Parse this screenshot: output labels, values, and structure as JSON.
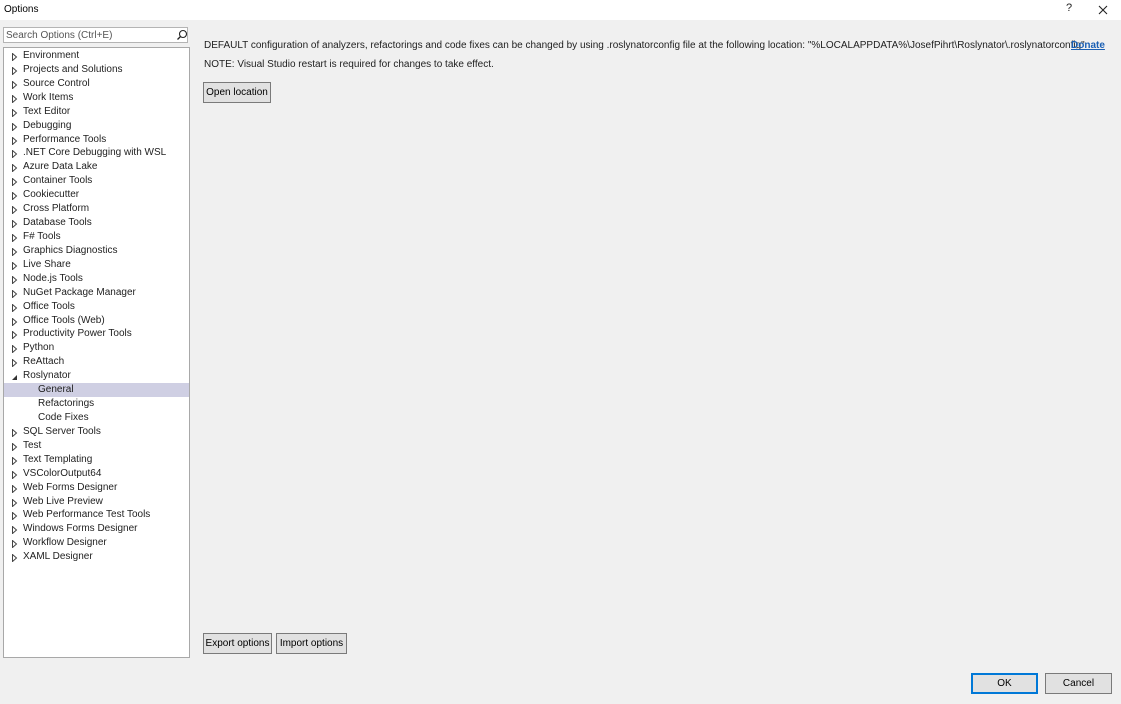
{
  "window": {
    "title": "Options",
    "help_label": "?"
  },
  "search": {
    "placeholder": "Search Options (Ctrl+E)",
    "value": ""
  },
  "tree": {
    "items": [
      {
        "label": "Environment",
        "expander": "collapsed"
      },
      {
        "label": "Projects and Solutions",
        "expander": "collapsed"
      },
      {
        "label": "Source Control",
        "expander": "collapsed"
      },
      {
        "label": "Work Items",
        "expander": "collapsed"
      },
      {
        "label": "Text Editor",
        "expander": "collapsed"
      },
      {
        "label": "Debugging",
        "expander": "collapsed"
      },
      {
        "label": "Performance Tools",
        "expander": "collapsed"
      },
      {
        "label": ".NET Core Debugging with WSL",
        "expander": "collapsed"
      },
      {
        "label": "Azure Data Lake",
        "expander": "collapsed"
      },
      {
        "label": "Container Tools",
        "expander": "collapsed"
      },
      {
        "label": "Cookiecutter",
        "expander": "collapsed"
      },
      {
        "label": "Cross Platform",
        "expander": "collapsed"
      },
      {
        "label": "Database Tools",
        "expander": "collapsed"
      },
      {
        "label": "F# Tools",
        "expander": "collapsed"
      },
      {
        "label": "Graphics Diagnostics",
        "expander": "collapsed"
      },
      {
        "label": "Live Share",
        "expander": "collapsed"
      },
      {
        "label": "Node.js Tools",
        "expander": "collapsed"
      },
      {
        "label": "NuGet Package Manager",
        "expander": "collapsed"
      },
      {
        "label": "Office Tools",
        "expander": "collapsed"
      },
      {
        "label": "Office Tools (Web)",
        "expander": "collapsed"
      },
      {
        "label": "Productivity Power Tools",
        "expander": "collapsed"
      },
      {
        "label": "Python",
        "expander": "collapsed"
      },
      {
        "label": "ReAttach",
        "expander": "collapsed"
      },
      {
        "label": "Roslynator",
        "expander": "expanded"
      },
      {
        "label": "General",
        "expander": "none",
        "child": true,
        "selected": true
      },
      {
        "label": "Refactorings",
        "expander": "none",
        "child": true
      },
      {
        "label": "Code Fixes",
        "expander": "none",
        "child": true
      },
      {
        "label": "SQL Server Tools",
        "expander": "collapsed"
      },
      {
        "label": "Test",
        "expander": "collapsed"
      },
      {
        "label": "Text Templating",
        "expander": "collapsed"
      },
      {
        "label": "VSColorOutput64",
        "expander": "collapsed"
      },
      {
        "label": "Web Forms Designer",
        "expander": "collapsed"
      },
      {
        "label": "Web Live Preview",
        "expander": "collapsed"
      },
      {
        "label": "Web Performance Test Tools",
        "expander": "collapsed"
      },
      {
        "label": "Windows Forms Designer",
        "expander": "collapsed"
      },
      {
        "label": "Workflow Designer",
        "expander": "collapsed"
      },
      {
        "label": "XAML Designer",
        "expander": "collapsed"
      }
    ]
  },
  "content": {
    "info": "DEFAULT configuration of analyzers, refactorings and code fixes can be changed by using .roslynatorconfig file at the following location: \"%LOCALAPPDATA%\\JosefPihrt\\Roslynator\\.roslynatorconfig\"",
    "note": "NOTE: Visual Studio restart is required for changes to take effect.",
    "donate_label": "Donate",
    "open_location_label": "Open location",
    "export_label": "Export options",
    "import_label": "Import options"
  },
  "footer": {
    "ok_label": "OK",
    "cancel_label": "Cancel"
  },
  "colors": {
    "accent": "#0078d7",
    "link": "#1a5fb4",
    "selection": "#cfcfe3"
  }
}
